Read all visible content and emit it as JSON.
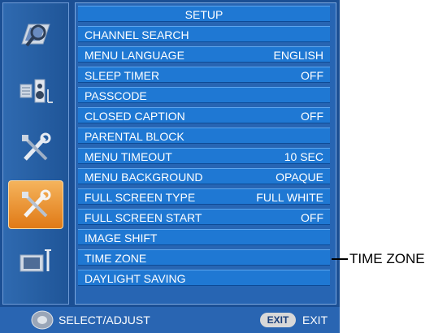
{
  "menu": {
    "title": "SETUP",
    "items": [
      {
        "label": "CHANNEL SEARCH",
        "value": ""
      },
      {
        "label": "MENU LANGUAGE",
        "value": "ENGLISH"
      },
      {
        "label": "SLEEP TIMER",
        "value": "OFF"
      },
      {
        "label": "PASSCODE",
        "value": ""
      },
      {
        "label": "CLOSED CAPTION",
        "value": "OFF"
      },
      {
        "label": "PARENTAL BLOCK",
        "value": ""
      },
      {
        "label": "MENU TIMEOUT",
        "value": "10 SEC"
      },
      {
        "label": "MENU BACKGROUND",
        "value": "OPAQUE"
      },
      {
        "label": "FULL SCREEN TYPE",
        "value": "FULL WHITE"
      },
      {
        "label": "FULL SCREEN START",
        "value": "OFF"
      },
      {
        "label": "IMAGE SHIFT",
        "value": ""
      },
      {
        "label": "TIME ZONE",
        "value": ""
      },
      {
        "label": "DAYLIGHT SAVING",
        "value": ""
      }
    ]
  },
  "sidebar": {
    "icons": [
      "picture-search-icon",
      "speaker-sound-icon",
      "tools-icon",
      "setup-tools-icon",
      "tv-antenna-icon"
    ],
    "active_index": 3
  },
  "footer": {
    "select_adjust": "SELECT/ADJUST",
    "exit_key": "EXIT",
    "exit_label": "EXIT"
  },
  "callout": {
    "label": "TIME ZONE"
  },
  "colors": {
    "row": "#1f78d3",
    "panel": "#2765b3",
    "active_tile": "#e07a16"
  }
}
